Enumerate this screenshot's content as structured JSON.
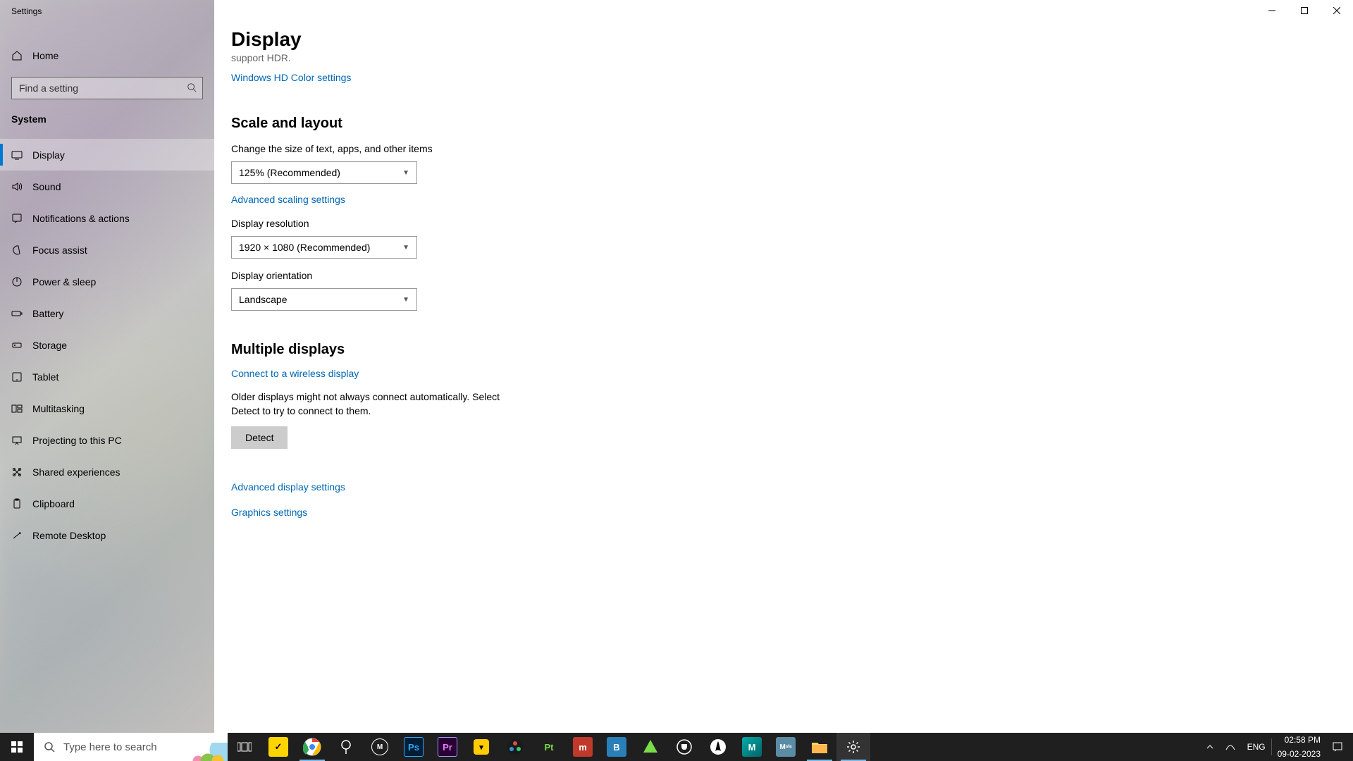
{
  "window": {
    "title": "Settings"
  },
  "sidebar": {
    "home": "Home",
    "search_placeholder": "Find a setting",
    "category": "System",
    "items": [
      {
        "label": "Display",
        "icon": "display-icon",
        "selected": true
      },
      {
        "label": "Sound",
        "icon": "sound-icon"
      },
      {
        "label": "Notifications & actions",
        "icon": "notifications-icon"
      },
      {
        "label": "Focus assist",
        "icon": "focus-assist-icon"
      },
      {
        "label": "Power & sleep",
        "icon": "power-icon"
      },
      {
        "label": "Battery",
        "icon": "battery-icon"
      },
      {
        "label": "Storage",
        "icon": "storage-icon"
      },
      {
        "label": "Tablet",
        "icon": "tablet-icon"
      },
      {
        "label": "Multitasking",
        "icon": "multitasking-icon"
      },
      {
        "label": "Projecting to this PC",
        "icon": "projecting-icon"
      },
      {
        "label": "Shared experiences",
        "icon": "shared-icon"
      },
      {
        "label": "Clipboard",
        "icon": "clipboard-icon"
      },
      {
        "label": "Remote Desktop",
        "icon": "remote-desktop-icon"
      }
    ]
  },
  "page": {
    "title": "Display",
    "hdr_truncated": "support HDR.",
    "links": {
      "hdr": "Windows HD Color settings",
      "adv_scaling": "Advanced scaling settings",
      "wireless": "Connect to a wireless display",
      "adv_display": "Advanced display settings",
      "graphics": "Graphics settings"
    },
    "sections": {
      "scale": "Scale and layout",
      "multiple": "Multiple displays"
    },
    "scale": {
      "size_label": "Change the size of text, apps, and other items",
      "size_value": "125% (Recommended)",
      "resolution_label": "Display resolution",
      "resolution_value": "1920 × 1080 (Recommended)",
      "orientation_label": "Display orientation",
      "orientation_value": "Landscape"
    },
    "multiple": {
      "detect_note": "Older displays might not always connect automatically. Select Detect to try to connect to them.",
      "detect_button": "Detect"
    }
  },
  "taskbar": {
    "search_placeholder": "Type here to search",
    "lang": "ENG",
    "time": "02:58 PM",
    "date": "09-02-2023"
  }
}
